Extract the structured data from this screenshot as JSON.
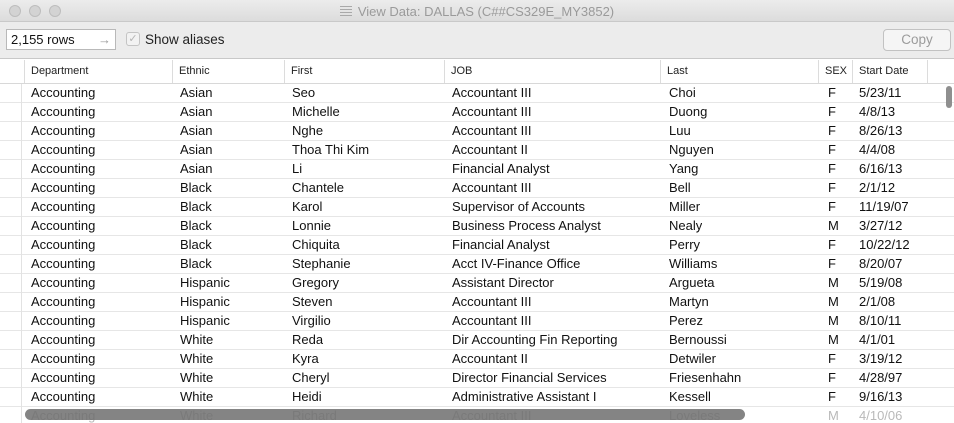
{
  "window": {
    "title": "View Data:  DALLAS (C##CS329E_MY3852)"
  },
  "toolbar": {
    "rows_value": "2,155 rows",
    "show_aliases_label": "Show aliases",
    "show_aliases_checked": true,
    "copy_label": "Copy"
  },
  "columns": [
    "Department",
    "Ethnic",
    "First",
    "JOB",
    "Last",
    "SEX",
    "Start Date"
  ],
  "rows": [
    [
      "Accounting",
      "Asian",
      "Seo",
      "Accountant III",
      "Choi",
      "F",
      "5/23/11"
    ],
    [
      "Accounting",
      "Asian",
      "Michelle",
      "Accountant III",
      "Duong",
      "F",
      "4/8/13"
    ],
    [
      "Accounting",
      "Asian",
      "Nghe",
      "Accountant III",
      "Luu",
      "F",
      "8/26/13"
    ],
    [
      "Accounting",
      "Asian",
      "Thoa Thi Kim",
      "Accountant II",
      "Nguyen",
      "F",
      "4/4/08"
    ],
    [
      "Accounting",
      "Asian",
      "Li",
      "Financial Analyst",
      "Yang",
      "F",
      "6/16/13"
    ],
    [
      "Accounting",
      "Black",
      "Chantele",
      "Accountant III",
      "Bell",
      "F",
      "2/1/12"
    ],
    [
      "Accounting",
      "Black",
      "Karol",
      "Supervisor of Accounts",
      "Miller",
      "F",
      "11/19/07"
    ],
    [
      "Accounting",
      "Black",
      "Lonnie",
      "Business Process Analyst",
      "Nealy",
      "M",
      "3/27/12"
    ],
    [
      "Accounting",
      "Black",
      "Chiquita",
      "Financial Analyst",
      "Perry",
      "F",
      "10/22/12"
    ],
    [
      "Accounting",
      "Black",
      "Stephanie",
      "Acct IV-Finance Office",
      "Williams",
      "F",
      "8/20/07"
    ],
    [
      "Accounting",
      "Hispanic",
      "Gregory",
      "Assistant Director",
      "Argueta",
      "M",
      "5/19/08"
    ],
    [
      "Accounting",
      "Hispanic",
      "Steven",
      "Accountant III",
      "Martyn",
      "M",
      "2/1/08"
    ],
    [
      "Accounting",
      "Hispanic",
      "Virgilio",
      "Accountant III",
      "Perez",
      "M",
      "8/10/11"
    ],
    [
      "Accounting",
      "White",
      "Reda",
      "Dir Accounting Fin Reporting",
      "Bernoussi",
      "M",
      "4/1/01"
    ],
    [
      "Accounting",
      "White",
      "Kyra",
      "Accountant II",
      "Detwiler",
      "F",
      "3/19/12"
    ],
    [
      "Accounting",
      "White",
      "Cheryl",
      "Director Financial Services",
      "Friesenhahn",
      "F",
      "4/28/97"
    ],
    [
      "Accounting",
      "White",
      "Heidi",
      "Administrative Assistant I",
      "Kessell",
      "F",
      "9/16/13"
    ],
    [
      "Accounting",
      "White",
      "Richard",
      "Accountant III",
      "Loveless",
      "M",
      "4/10/06"
    ]
  ]
}
